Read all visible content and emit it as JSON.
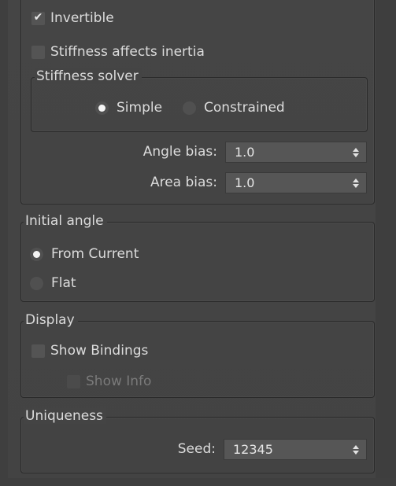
{
  "options": {
    "invertible": {
      "label": "Invertible",
      "checked": true
    },
    "stiffness_affects_inertia": {
      "label": "Stiffness affects inertia",
      "checked": false
    }
  },
  "stiffness_solver": {
    "title": "Stiffness solver",
    "simple": {
      "label": "Simple",
      "selected": true
    },
    "constrained": {
      "label": "Constrained",
      "selected": false
    }
  },
  "angle_bias": {
    "label": "Angle bias:",
    "value": "1.0"
  },
  "area_bias": {
    "label": "Area bias:",
    "value": "1.0"
  },
  "initial_angle": {
    "title": "Initial angle",
    "from_current": {
      "label": "From Current",
      "selected": true
    },
    "flat": {
      "label": "Flat",
      "selected": false
    }
  },
  "display": {
    "title": "Display",
    "show_bindings": {
      "label": "Show Bindings",
      "checked": false
    },
    "show_info": {
      "label": "Show Info",
      "checked": false,
      "enabled": false
    }
  },
  "uniqueness": {
    "title": "Uniqueness",
    "seed": {
      "label": "Seed:",
      "value": "12345"
    }
  },
  "colors": {
    "panel_bg": "#444444",
    "text": "#dcdcdc",
    "field_bg": "#565656",
    "radio_dot": "#f4f4f4"
  }
}
